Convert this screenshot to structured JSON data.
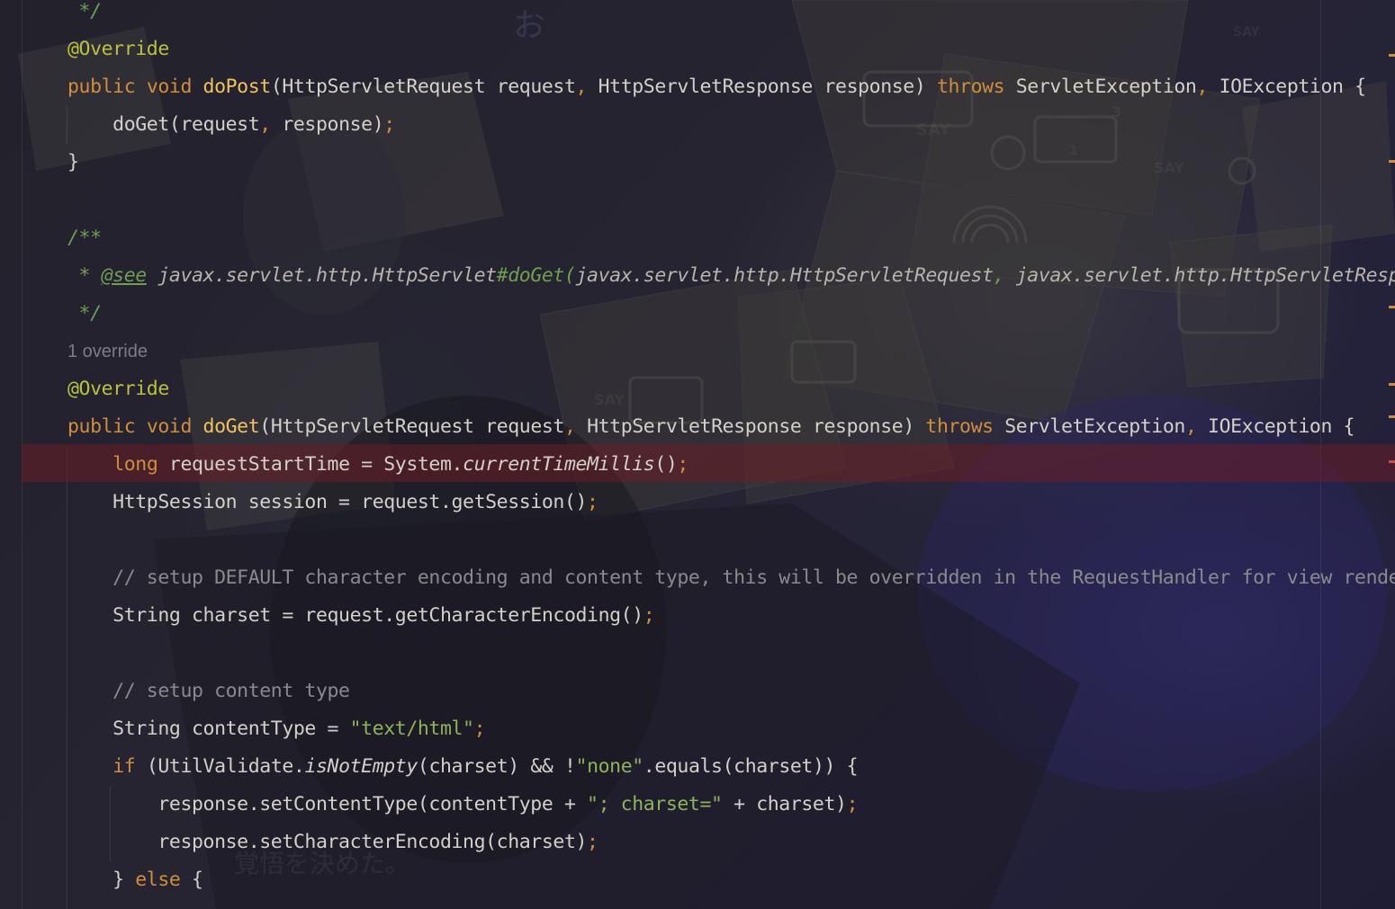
{
  "editor": {
    "inlay_hint": "1 override",
    "lines": [
      [
        [
          "doc",
          " */"
        ]
      ],
      [
        [
          "ann",
          "@Override"
        ]
      ],
      [
        [
          "kw",
          "public "
        ],
        [
          "kw",
          "void "
        ],
        [
          "fn",
          "doPost"
        ],
        [
          "t",
          "(HttpServletRequest request"
        ],
        [
          "punc",
          ", "
        ],
        [
          "t",
          "HttpServletResponse response) "
        ],
        [
          "kw",
          "throws "
        ],
        [
          "t",
          "ServletException"
        ],
        [
          "punc",
          ", "
        ],
        [
          "t",
          "IOException {"
        ]
      ],
      [
        [
          "t",
          "    doGet(request"
        ],
        [
          "punc",
          ", "
        ],
        [
          "t",
          "response)"
        ],
        [
          "punc",
          ";"
        ]
      ],
      [
        [
          "t",
          "}"
        ]
      ],
      [
        [
          "t",
          ""
        ]
      ],
      [
        [
          "doc",
          "/**"
        ]
      ],
      [
        [
          "doc",
          " * "
        ],
        [
          "doctag",
          "@see"
        ],
        [
          "doct",
          " javax.servlet.http.HttpServlet"
        ],
        [
          "doc",
          "#doGet("
        ],
        [
          "doct",
          "javax.servlet.http.HttpServletRequest"
        ],
        [
          "doc",
          ", "
        ],
        [
          "doct",
          "javax.servlet.http.HttpServletResponse"
        ],
        [
          "doc",
          ")"
        ]
      ],
      [
        [
          "doc",
          " */"
        ]
      ],
      [
        [
          "t",
          ""
        ]
      ],
      [
        [
          "ann",
          "@Override"
        ]
      ],
      [
        [
          "kw",
          "public "
        ],
        [
          "kw",
          "void "
        ],
        [
          "fn",
          "doGet"
        ],
        [
          "t",
          "(HttpServletRequest request"
        ],
        [
          "punc",
          ", "
        ],
        [
          "t",
          "HttpServletResponse response) "
        ],
        [
          "kw",
          "throws "
        ],
        [
          "t",
          "ServletException"
        ],
        [
          "punc",
          ", "
        ],
        [
          "t",
          "IOException {"
        ]
      ],
      [
        [
          "t",
          "    "
        ],
        [
          "kw",
          "long "
        ],
        [
          "t",
          "requestStartTime = System."
        ],
        [
          "it",
          "currentTimeMillis"
        ],
        [
          "t",
          "()"
        ],
        [
          "punc",
          ";"
        ]
      ],
      [
        [
          "t",
          "    HttpSession session = request.getSession()"
        ],
        [
          "punc",
          ";"
        ]
      ],
      [
        [
          "t",
          ""
        ]
      ],
      [
        [
          "cmt",
          "    // setup DEFAULT character encoding and content type, this will be overridden in the RequestHandler for view rendering"
        ]
      ],
      [
        [
          "t",
          "    String charset = request.getCharacterEncoding()"
        ],
        [
          "punc",
          ";"
        ]
      ],
      [
        [
          "t",
          ""
        ]
      ],
      [
        [
          "cmt",
          "    // setup content type"
        ]
      ],
      [
        [
          "t",
          "    String contentType = "
        ],
        [
          "str",
          "\"text/html\""
        ],
        [
          "punc",
          ";"
        ]
      ],
      [
        [
          "t",
          "    "
        ],
        [
          "kw",
          "if "
        ],
        [
          "t",
          "(UtilValidate."
        ],
        [
          "it",
          "isNotEmpty"
        ],
        [
          "t",
          "(charset) && !"
        ],
        [
          "str",
          "\"none\""
        ],
        [
          "t",
          ".equals(charset)) {"
        ]
      ],
      [
        [
          "t",
          "        response.setContentType(contentType + "
        ],
        [
          "str",
          "\"; charset=\""
        ],
        [
          "t",
          " + charset)"
        ],
        [
          "punc",
          ";"
        ]
      ],
      [
        [
          "t",
          "        response.setCharacterEncoding(charset)"
        ],
        [
          "punc",
          ";"
        ]
      ],
      [
        [
          "t",
          "    } "
        ],
        [
          "kw",
          "else "
        ],
        [
          "t",
          "{"
        ]
      ]
    ]
  },
  "background_text": {
    "say_1": "SAY",
    "say_2": "SAY",
    "say_3": "SAY",
    "say_4": "SAY",
    "num_1": "3",
    "num_2": "1",
    "jp_watermark": "覚悟を決めた。",
    "jp_glyph": "お"
  },
  "colors": {
    "keyword": "#cf8e3a",
    "annotation": "#b9c23a",
    "method_declaration": "#f0c35c",
    "string": "#8fb35a",
    "comment": "#8a8a8e",
    "doc_comment": "#6f9e52",
    "text": "#d4d0c8",
    "error_line": "#691e26",
    "background": "#1f1e2b"
  }
}
